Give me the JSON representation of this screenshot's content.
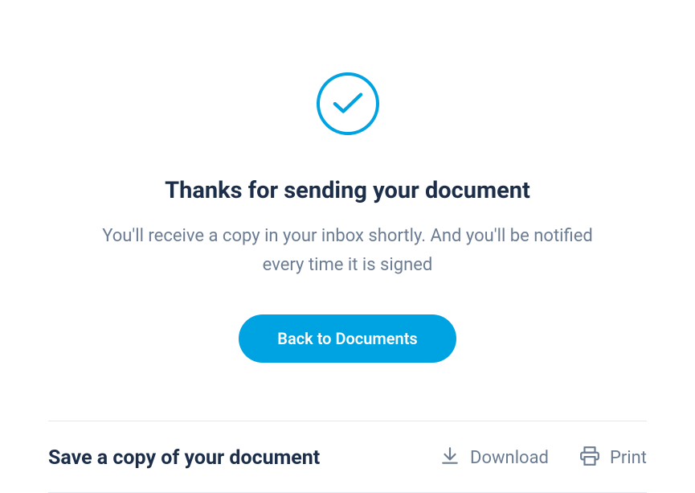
{
  "hero": {
    "heading": "Thanks for sending your document",
    "subtext": "You'll receive a copy in your inbox shortly. And you'll be notified every time it is signed",
    "cta_label": "Back to Documents"
  },
  "save_section": {
    "title": "Save a copy of your document",
    "download_label": "Download",
    "print_label": "Print"
  },
  "colors": {
    "accent": "#00A3E1",
    "text_primary": "#1c2e4a",
    "text_secondary": "#6b7c93"
  }
}
